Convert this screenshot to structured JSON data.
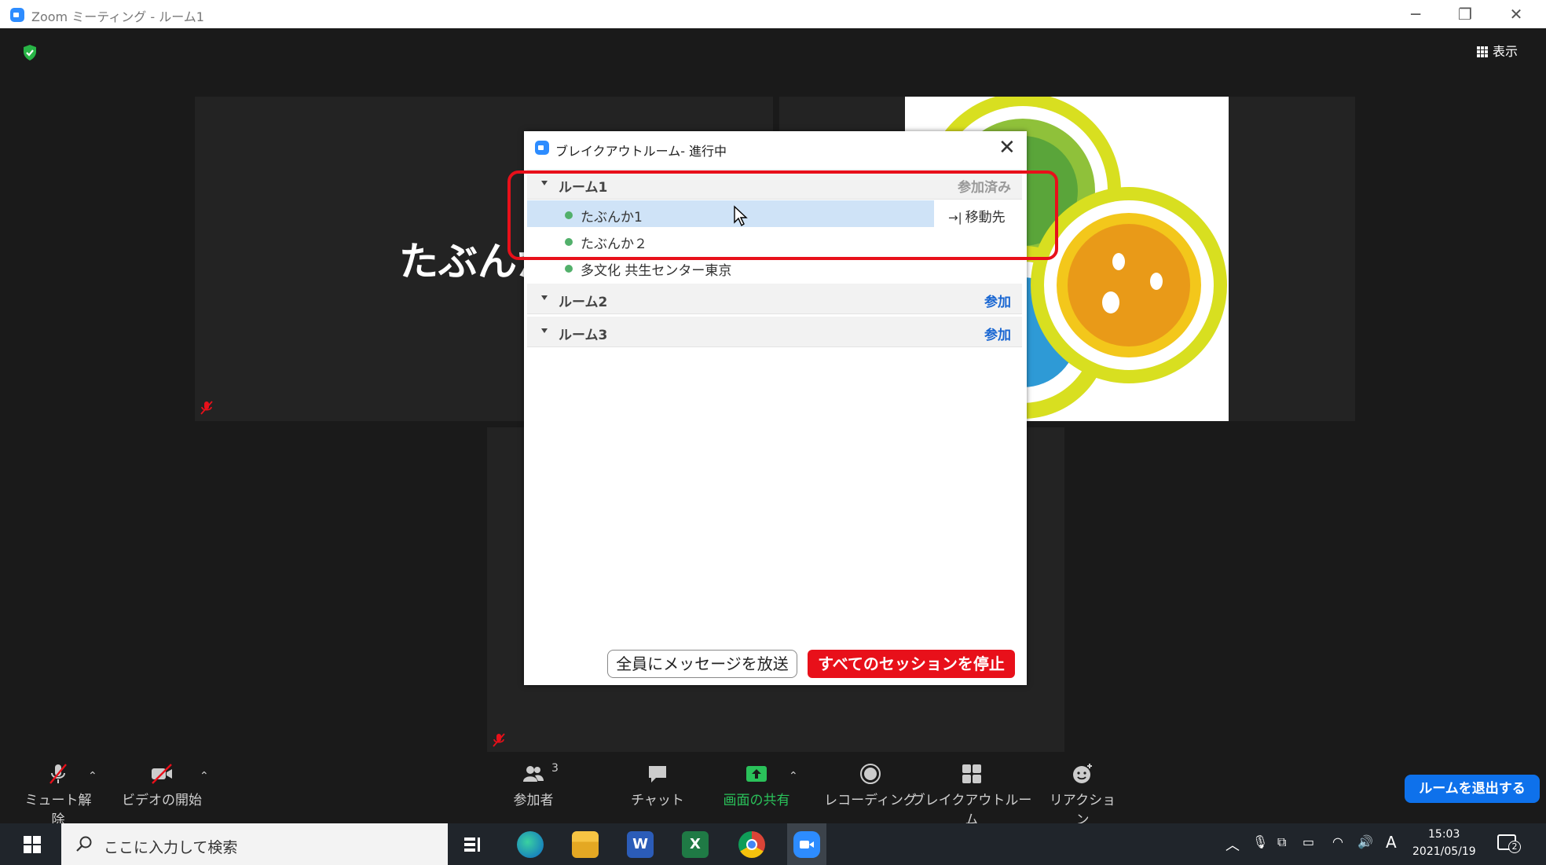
{
  "window": {
    "title": "Zoom ミーティング - ルーム1"
  },
  "view_button": {
    "label": "表示"
  },
  "tiles": {
    "big_name": "たぶんか"
  },
  "dialog": {
    "title": "ブレイクアウトルーム- 進行中",
    "rooms": [
      {
        "name": "ルーム1",
        "action": "参加済み",
        "participants": [
          "たぶんか1",
          "たぶんか２",
          "多文化 共生センター東京"
        ]
      },
      {
        "name": "ルーム2",
        "action": "参加"
      },
      {
        "name": "ルーム3",
        "action": "参加"
      }
    ],
    "move_label": "移動先",
    "broadcast_button": "全員にメッセージを放送",
    "stop_button": "すべてのセッションを停止"
  },
  "toolbar": {
    "unmute": "ミュート解除",
    "start_video": "ビデオの開始",
    "participants": "参加者",
    "participants_count": "3",
    "chat": "チャット",
    "share": "画面の共有",
    "record": "レコーディング",
    "breakout": "ブレイクアウトルーム",
    "reaction": "リアクション",
    "leave_room": "ルームを退出する"
  },
  "taskbar": {
    "search_placeholder": "ここに入力して検索",
    "time": "15:03",
    "date": "2021/05/19",
    "ime": "A",
    "notifications": "2"
  },
  "colors": {
    "accent": "#0e71eb",
    "danger": "#e8101a",
    "active": "#52b06b"
  }
}
